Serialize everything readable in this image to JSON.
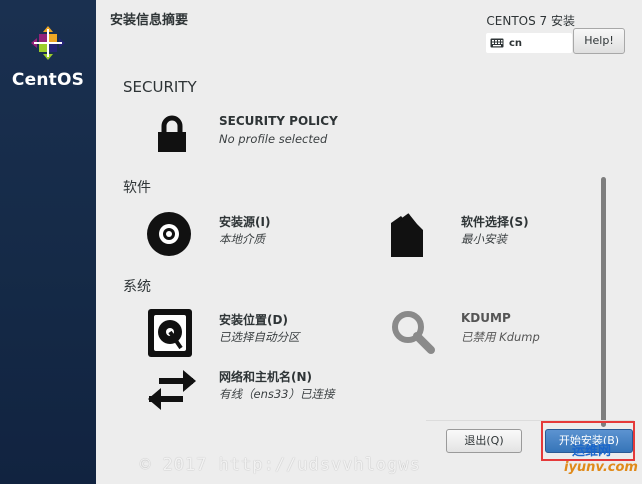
{
  "sidebar": {
    "brand": "CentOS"
  },
  "header": {
    "title": "安装信息摘要",
    "product": "CENTOS 7 安装",
    "keyboard_layout": "cn",
    "help_label": "Help!"
  },
  "categories": {
    "security": "SECURITY",
    "software": "软件",
    "system": "系统"
  },
  "spokes": {
    "security_policy": {
      "name": "SECURITY POLICY",
      "status": "No profile selected",
      "icon": "lock-icon"
    },
    "install_source": {
      "name": "安装源(I)",
      "status": "本地介质",
      "icon": "disc-icon"
    },
    "software_selection": {
      "name": "软件选择(S)",
      "status": "最小安装",
      "icon": "package-icon"
    },
    "install_destination": {
      "name": "安装位置(D)",
      "status": "已选择自动分区",
      "icon": "harddisk-icon"
    },
    "kdump": {
      "name": "KDUMP",
      "status": "已禁用 Kdump",
      "icon": "magnifier-icon"
    },
    "network_hostname": {
      "name": "网络和主机名(N)",
      "status": "有线（ens33）已连接",
      "icon": "network-arrows-icon"
    }
  },
  "footer": {
    "quit_label": "退出(Q)",
    "begin_label": "开始安装(B)"
  },
  "watermark": "© 2017 http://udsvvhlogws",
  "site_logo": {
    "line1": "运维网",
    "line2": "iyunv.com"
  },
  "colors": {
    "sidebar": "#152a47",
    "begin_button": "#3675b8",
    "highlight_box": "#e53a3a"
  }
}
